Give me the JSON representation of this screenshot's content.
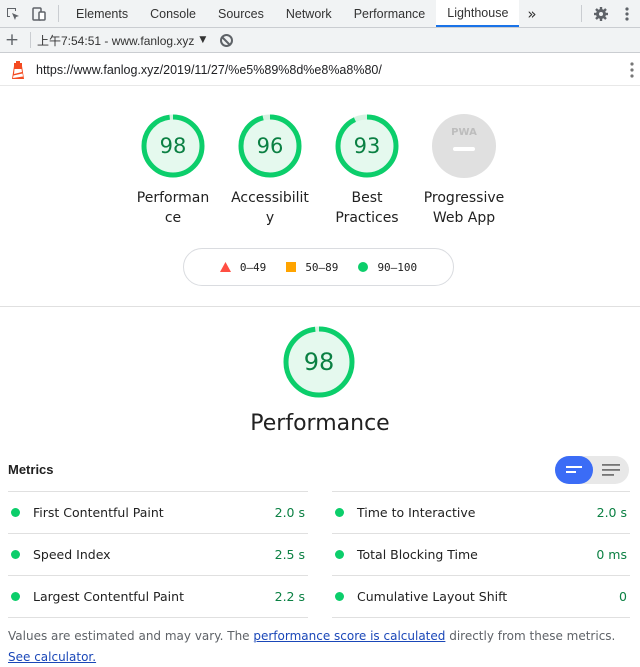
{
  "devtools": {
    "tabs": [
      "Elements",
      "Console",
      "Sources",
      "Network",
      "Performance",
      "Lighthouse"
    ],
    "active_tab": "Lighthouse",
    "more": "»"
  },
  "toolbar": {
    "report_label": "上午7:54:51 - www.fanlog.xyz",
    "caret": "▼"
  },
  "url": "https://www.fanlog.xyz/2019/11/27/%e5%89%8d%e8%a8%80/",
  "gauges": [
    {
      "score": "98",
      "label": "Performance",
      "level": 0.98
    },
    {
      "score": "96",
      "label": "Accessibility",
      "level": 0.96
    },
    {
      "score": "93",
      "label": "Best Practices",
      "level": 0.93
    },
    {
      "score": "PWA",
      "label": "Progressive Web App",
      "level": 0
    }
  ],
  "legend": {
    "fail": "0–49",
    "average": "50–89",
    "pass": "90–100"
  },
  "colors": {
    "pass": "#0cce6b",
    "pass_text": "#0b8043",
    "average": "#ffa400",
    "fail": "#ff4e42",
    "accent": "#1a73e8"
  },
  "performance": {
    "score": "98",
    "level": 0.98,
    "title": "Performance"
  },
  "metrics": {
    "heading": "Metrics",
    "items": [
      {
        "name": "First Contentful Paint",
        "value": "2.0 s"
      },
      {
        "name": "Time to Interactive",
        "value": "2.0 s"
      },
      {
        "name": "Speed Index",
        "value": "2.5 s"
      },
      {
        "name": "Total Blocking Time",
        "value": "0 ms"
      },
      {
        "name": "Largest Contentful Paint",
        "value": "2.2 s"
      },
      {
        "name": "Cumulative Layout Shift",
        "value": "0"
      }
    ]
  },
  "footer": {
    "text1": "Values are estimated and may vary. The ",
    "link1": "performance score is calculated",
    "text2": " directly from these metrics. ",
    "link2": "See calculator."
  }
}
